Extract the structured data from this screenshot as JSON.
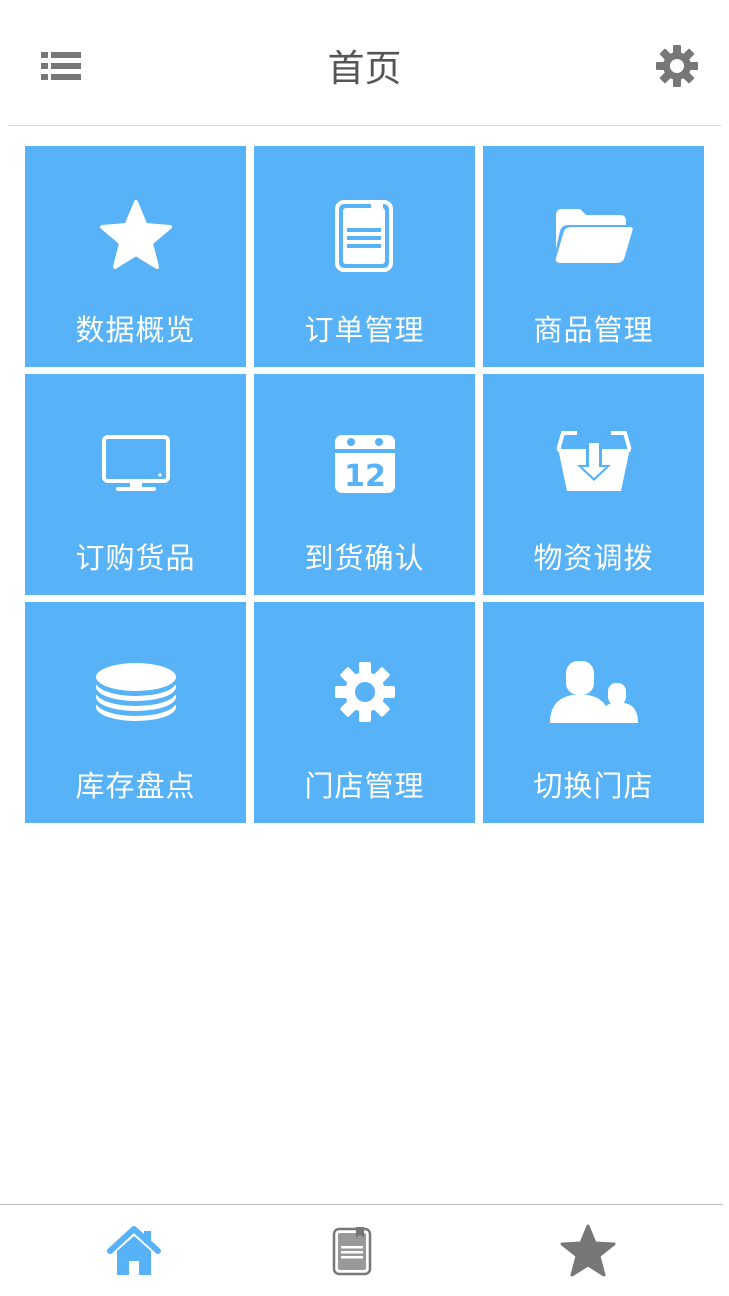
{
  "header": {
    "title": "首页",
    "menu_icon": "list-icon",
    "settings_icon": "gear-icon"
  },
  "colors": {
    "tile_bg": "#57b2f7",
    "tile_fg": "#ffffff",
    "title_text": "#555555",
    "header_icon": "#777777",
    "tab_active": "#57b2f7",
    "tab_inactive": "#777777"
  },
  "tiles": [
    {
      "label": "数据概览",
      "icon": "star-icon"
    },
    {
      "label": "订单管理",
      "icon": "document-icon"
    },
    {
      "label": "商品管理",
      "icon": "folder-icon"
    },
    {
      "label": "订购货品",
      "icon": "monitor-icon"
    },
    {
      "label": "到货确认",
      "icon": "calendar-icon"
    },
    {
      "label": "物资调拨",
      "icon": "basket-download-icon"
    },
    {
      "label": "库存盘点",
      "icon": "database-icon"
    },
    {
      "label": "门店管理",
      "icon": "gear-icon"
    },
    {
      "label": "切换门店",
      "icon": "users-icon"
    }
  ],
  "calendar_day": "12",
  "tabbar": [
    {
      "icon": "home-icon",
      "active": true
    },
    {
      "icon": "document-icon",
      "active": false
    },
    {
      "icon": "star-icon",
      "active": false
    }
  ]
}
